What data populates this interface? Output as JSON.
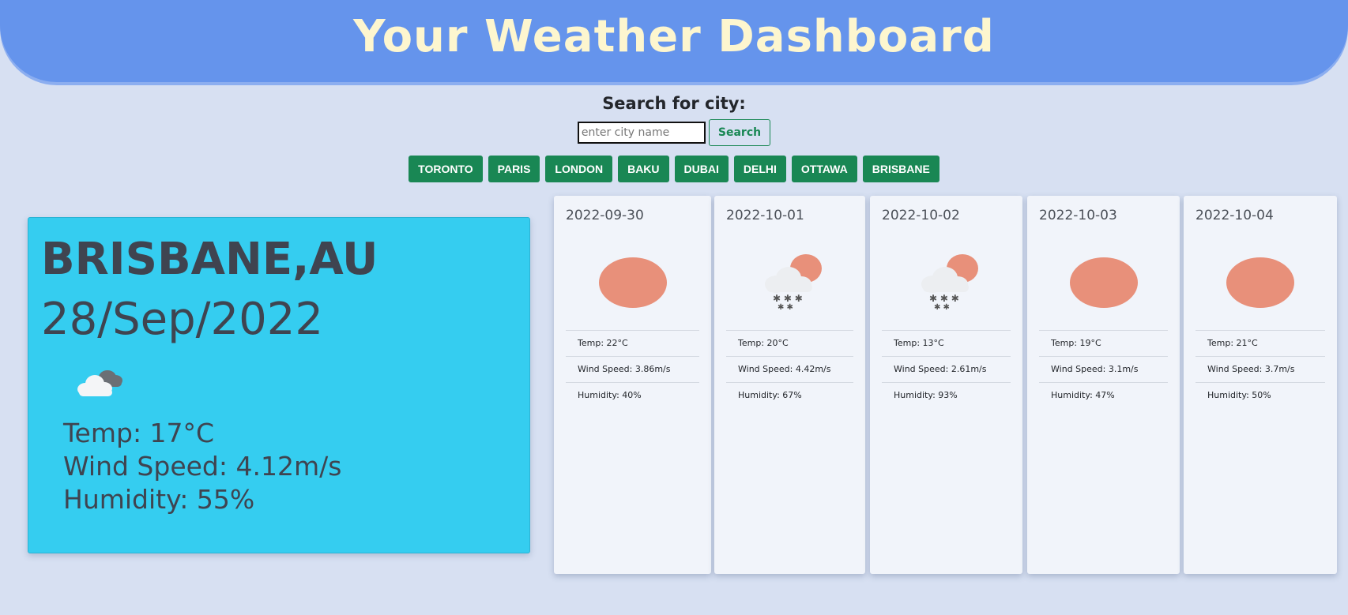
{
  "header": {
    "title": "Your Weather Dashboard"
  },
  "search": {
    "label": "Search for city:",
    "placeholder": "enter city name",
    "value": "",
    "button_label": "Search"
  },
  "history": [
    {
      "label": "TORONTO"
    },
    {
      "label": "PARIS"
    },
    {
      "label": "LONDON"
    },
    {
      "label": "BAKU"
    },
    {
      "label": "DUBAI"
    },
    {
      "label": "DELHI"
    },
    {
      "label": "OTTAWA"
    },
    {
      "label": "BRISBANE"
    }
  ],
  "current": {
    "city": "BRISBANE,AU",
    "date": "28/Sep/2022",
    "icon": "cloudy-icon",
    "temp": "Temp: 17°C",
    "wind": "Wind Speed: 4.12m/s",
    "humidity": "Humidity: 55%"
  },
  "forecast": [
    {
      "date": "2022-09-30",
      "icon": "sun-icon",
      "temp": "Temp: 22°C",
      "wind": "Wind Speed: 3.86m/s",
      "humidity": "Humidity: 40%"
    },
    {
      "date": "2022-10-01",
      "icon": "snow-sun-icon",
      "temp": "Temp: 20°C",
      "wind": "Wind Speed: 4.42m/s",
      "humidity": "Humidity: 67%"
    },
    {
      "date": "2022-10-02",
      "icon": "snow-sun-icon",
      "temp": "Temp: 13°C",
      "wind": "Wind Speed: 2.61m/s",
      "humidity": "Humidity: 93%"
    },
    {
      "date": "2022-10-03",
      "icon": "sun-icon",
      "temp": "Temp: 19°C",
      "wind": "Wind Speed: 3.1m/s",
      "humidity": "Humidity: 47%"
    },
    {
      "date": "2022-10-04",
      "icon": "sun-icon",
      "temp": "Temp: 21°C",
      "wind": "Wind Speed: 3.7m/s",
      "humidity": "Humidity: 50%"
    }
  ],
  "colors": {
    "header_bg": "#6594ec",
    "header_text": "#fdf6cf",
    "page_bg": "#d7e0f2",
    "current_bg": "#35cdf0",
    "button_green": "#198754",
    "sun": "#e8907a"
  }
}
